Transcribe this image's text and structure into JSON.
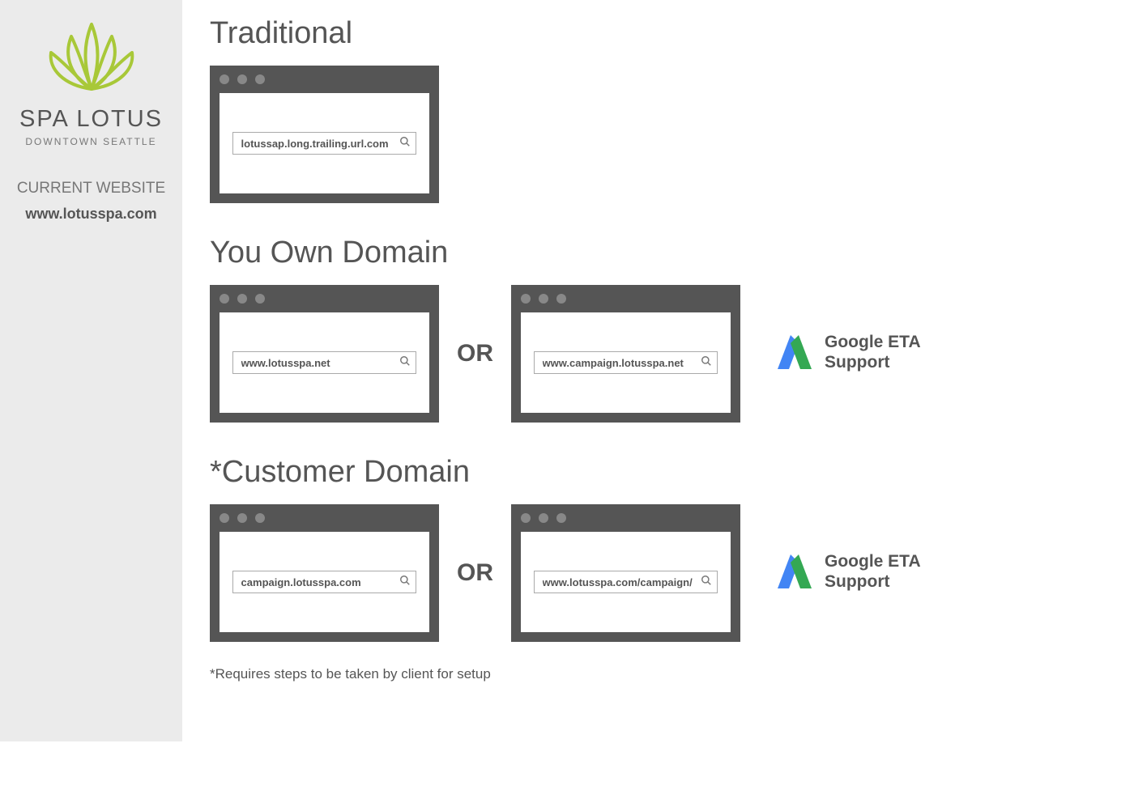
{
  "sidebar": {
    "brand_name": "SPA LOTUS",
    "brand_sub": "DOWNTOWN SEATTLE",
    "current_label": "CURRENT WEBSITE",
    "current_url": "www.lotusspa.com"
  },
  "sections": {
    "traditional": {
      "title": "Traditional",
      "browser1_url": "lotussap.long.trailing.url.com"
    },
    "own_domain": {
      "title": "You Own Domain",
      "browser1_url": "www.lotusspa.net",
      "browser2_url": "www.campaign.lotusspa.net",
      "or_label": "OR",
      "eta_line1": "Google ETA",
      "eta_line2": "Support"
    },
    "customer_domain": {
      "title": "*Customer Domain",
      "browser1_url": "campaign.lotusspa.com",
      "browser2_url": "www.lotusspa.com/campaign/",
      "or_label": "OR",
      "eta_line1": "Google ETA",
      "eta_line2": "Support"
    }
  },
  "footnote": "*Requires steps to be taken by client for setup",
  "colors": {
    "lotus_green": "#a8c838",
    "adwords_blue": "#4285F4",
    "adwords_green": "#34A853",
    "browser_gray": "#555555"
  }
}
